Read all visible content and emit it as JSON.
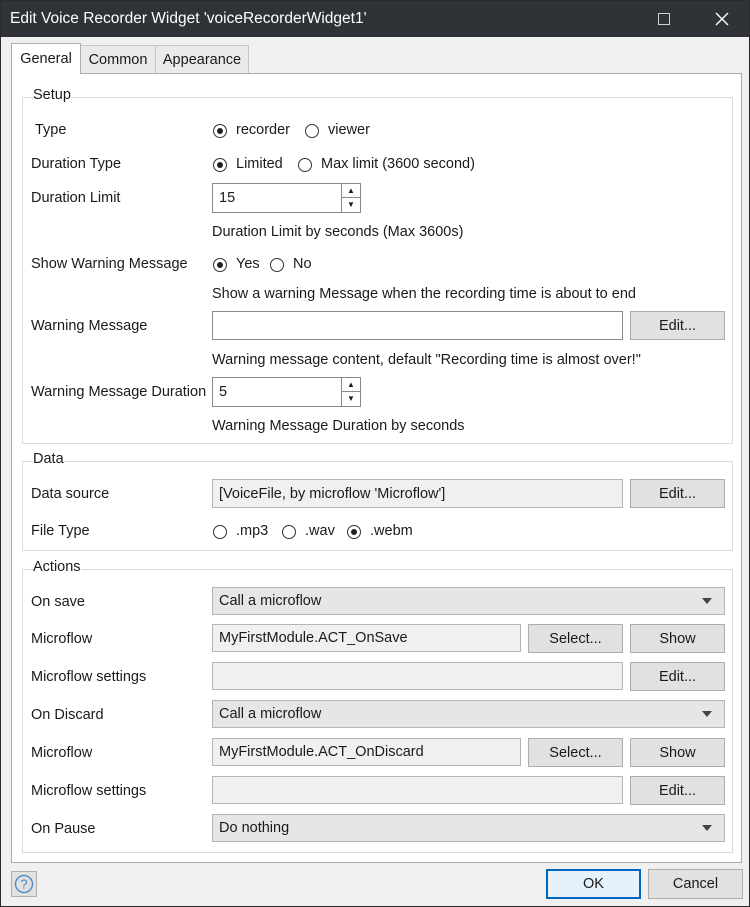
{
  "window": {
    "title": "Edit Voice Recorder Widget 'voiceRecorderWidget1'"
  },
  "tabs": [
    {
      "label": "General"
    },
    {
      "label": "Common"
    },
    {
      "label": "Appearance"
    }
  ],
  "setup": {
    "title": "Setup",
    "type_label": "Type",
    "type_options": [
      {
        "label": "recorder",
        "selected": true
      },
      {
        "label": "viewer",
        "selected": false
      }
    ],
    "duration_type_label": "Duration Type",
    "duration_type_options": [
      {
        "label": "Limited",
        "selected": true
      },
      {
        "label": "Max limit (3600 second)",
        "selected": false
      }
    ],
    "duration_limit_label": "Duration Limit",
    "duration_limit_value": "15",
    "duration_limit_help": "Duration Limit by seconds (Max 3600s)",
    "show_warning_label": "Show Warning Message",
    "show_warning_options": [
      {
        "label": "Yes",
        "selected": true
      },
      {
        "label": "No",
        "selected": false
      }
    ],
    "show_warning_help": "Show a warning Message when the recording time is about to end",
    "warning_message_label": "Warning Message",
    "warning_message_value": "",
    "warning_message_edit": "Edit...",
    "warning_message_help": "Warning message content, default \"Recording time is almost over!\"",
    "warning_duration_label": "Warning Message Duration",
    "warning_duration_value": "5",
    "warning_duration_help": "Warning Message Duration by seconds"
  },
  "data": {
    "title": "Data",
    "data_source_label": "Data source",
    "data_source_value": "[VoiceFile, by microflow 'Microflow']",
    "data_source_edit": "Edit...",
    "file_type_label": "File Type",
    "file_type_options": [
      {
        "label": ".mp3",
        "selected": false
      },
      {
        "label": ".wav",
        "selected": false
      },
      {
        "label": ".webm",
        "selected": true
      }
    ]
  },
  "actions": {
    "title": "Actions",
    "on_save_label": "On save",
    "on_save_value": "Call a microflow",
    "microflow1_label": "Microflow",
    "microflow1_value": "MyFirstModule.ACT_OnSave",
    "select_label": "Select...",
    "show_label": "Show",
    "settings1_label": "Microflow settings",
    "settings1_value": "",
    "edit_label": "Edit...",
    "on_discard_label": "On Discard",
    "on_discard_value": "Call a microflow",
    "microflow2_label": "Microflow",
    "microflow2_value": "MyFirstModule.ACT_OnDiscard",
    "settings2_label": "Microflow settings",
    "settings2_value": "",
    "on_pause_label": "On Pause",
    "on_pause_value": "Do nothing"
  },
  "footer": {
    "ok_label": "OK",
    "cancel_label": "Cancel"
  },
  "colors": {
    "titlebar": "#2f3338",
    "accent": "#0067c0"
  }
}
